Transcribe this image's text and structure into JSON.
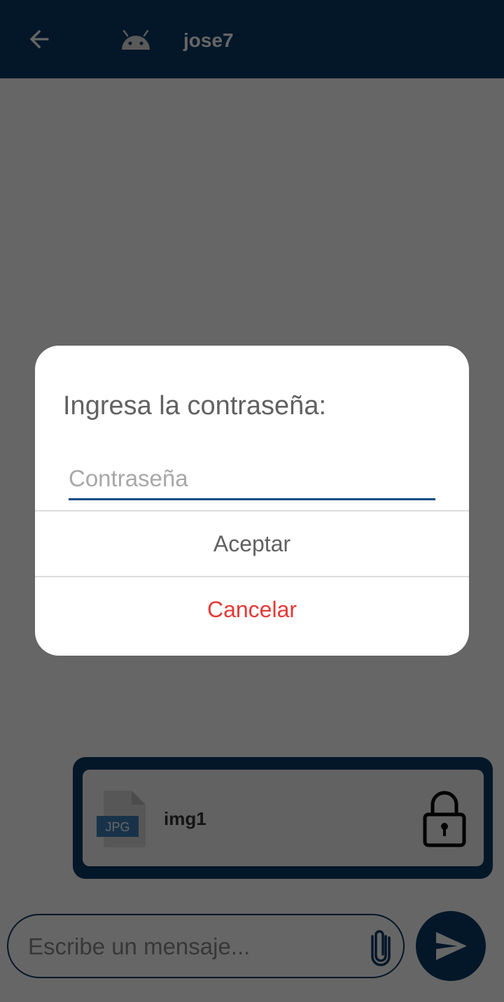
{
  "header": {
    "title": "jose7",
    "back_icon": "arrow-back-icon",
    "avatar_icon": "android-avatar-icon"
  },
  "message": {
    "file_type": "JPG",
    "file_name": "img1",
    "status_icon": "lock-icon"
  },
  "composer": {
    "placeholder": "Escribe un mensaje...",
    "attach_icon": "paperclip-icon",
    "send_icon": "send-icon"
  },
  "dialog": {
    "title": "Ingresa la contraseña:",
    "password_placeholder": "Contraseña",
    "accept_label": "Aceptar",
    "cancel_label": "Cancelar"
  },
  "colors": {
    "primary": "#0b3a66",
    "cancel": "#e53935",
    "field_underline": "#0b4c86"
  }
}
